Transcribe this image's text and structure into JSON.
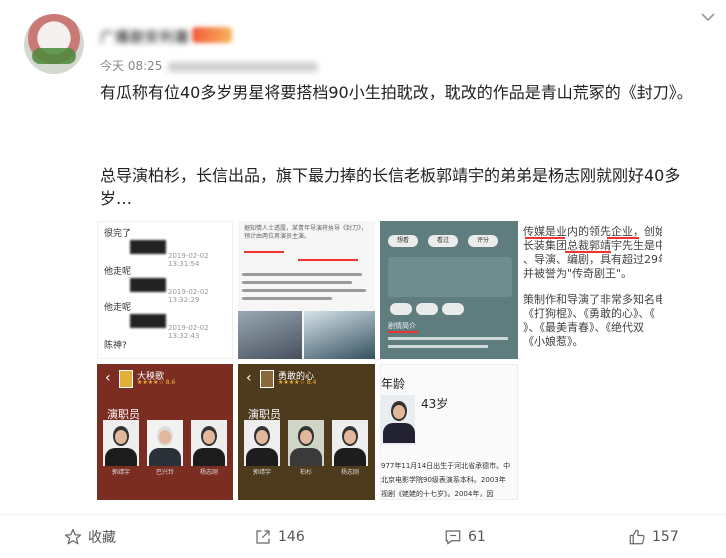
{
  "post": {
    "username": "广播剧安利菌",
    "time": "今天 08:25",
    "source": "来自 微博客户端",
    "paragraph_1": "有瓜称有位40多岁男星将要搭档90小生拍耽改，耽改的作品是青山荒冢的《封刀》。",
    "paragraph_2": "总导演柏杉，长信出品，旗下最力捧的长信老板郭靖宇的弟弟是杨志刚就刚好40多岁…"
  },
  "images": {
    "chat": {
      "rows": [
        "很完了",
        "他走呢",
        "他走呢",
        "陈神?"
      ],
      "timestamps": [
        "2019-02-02 13:31:54",
        "2019-02-02 13:32:29",
        "2019-02-02 13:32:43"
      ]
    },
    "article": {
      "caption": "据知情人士透露，某青年导演将执导《封刀》，预计由两位男演员主演。"
    },
    "app": {
      "pills": [
        "想看",
        "看过",
        "评分"
      ],
      "tabs": [
        "剧情简介"
      ]
    },
    "excerpt": {
      "lines": [
        "传媒是业内的领先企业，创始人，",
        "长装集团总裁郭靖宇先生是中国知",
        "、导演、编剧，具有超过29年的行",
        "并被誉为\"传奇剧王\"。",
        "",
        "策制作和导演了非常多知名电视剧",
        "《打狗棍》、《勇敢的心》、《",
        "》、《最美青春》、《绝代双",
        "《小娘惹》。"
      ]
    },
    "cast1": {
      "film_title": "大秧歌",
      "stars": "★★★★☆ 8.6",
      "section": "演职员",
      "people": [
        "郭靖宇",
        "巴兴玲",
        "杨志刚"
      ]
    },
    "cast2": {
      "film_title": "勇敢的心",
      "stars": "★★★★☆ 8.4",
      "section": "演职员",
      "people": [
        "郭靖宇",
        "柏杉",
        "杨志刚"
      ]
    },
    "bio": {
      "label": "年龄",
      "value": "43岁",
      "lines": [
        "977年11月14日出生于河北省承德市。中",
        "北京电影学院90级表演系本科。2003年",
        "视剧《姥姥的十七岁》。2004年，因"
      ]
    }
  },
  "actions": {
    "favorite": "收藏",
    "share": "146",
    "comment": "61",
    "like": "157"
  },
  "colors": {
    "text": "#222222",
    "meta": "#888888",
    "link_red": "#ee3333"
  }
}
